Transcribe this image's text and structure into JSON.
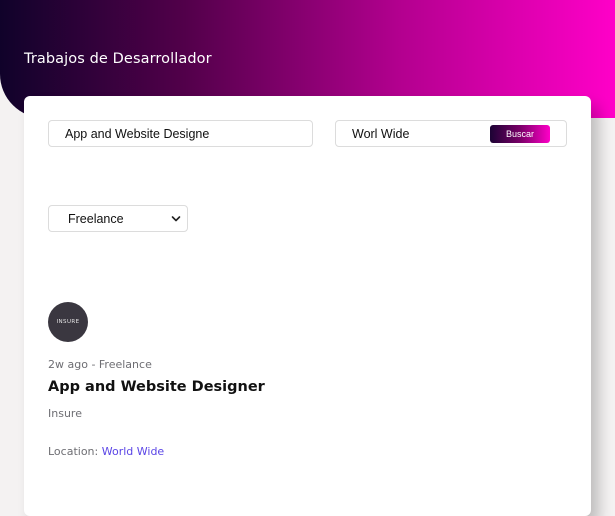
{
  "header": {
    "title": "Trabajos de Desarrollador"
  },
  "search": {
    "query_value": "App and Website Designe",
    "location_value": "Worl Wide",
    "button_label": "Buscar"
  },
  "filter": {
    "job_type_selected": "Freelance"
  },
  "job": {
    "logo_text": "INSURE",
    "meta": "2w ago - Freelance",
    "title": "App and Website Designer",
    "company": "Insure",
    "location_label": "Location:",
    "location_value": "World Wide"
  },
  "colors": {
    "hero_gradient_start": "#10022a",
    "hero_gradient_end": "#ff00c8",
    "link": "#5a45e6"
  },
  "icons": {
    "select_caret": "chevron-down-icon"
  }
}
